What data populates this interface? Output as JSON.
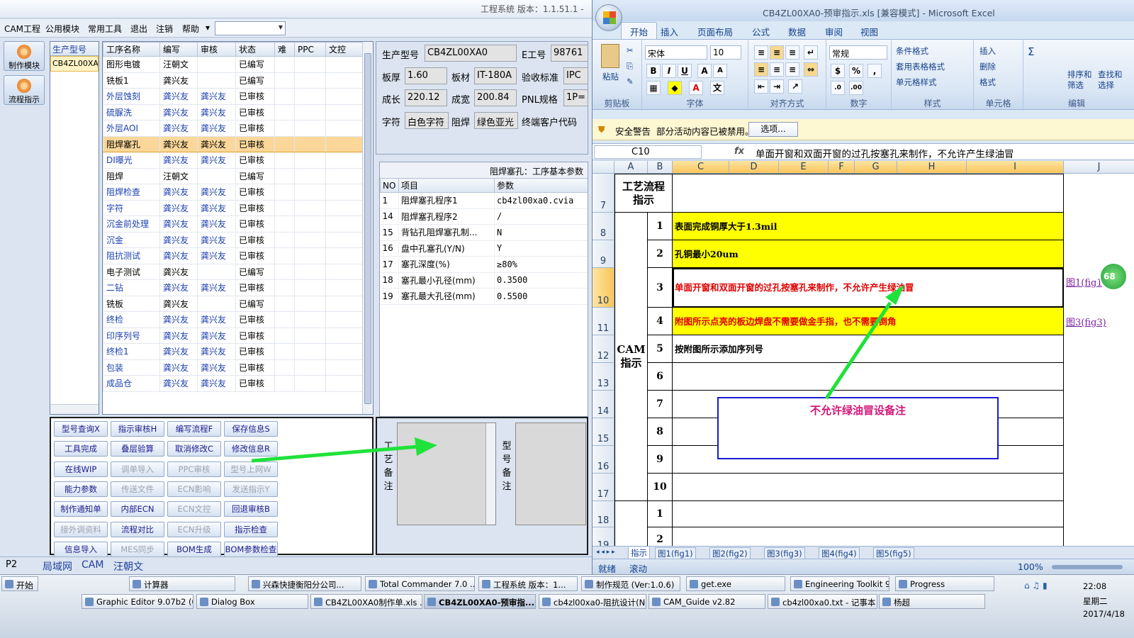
{
  "app": {
    "title": "工程系统  版本：1.1.51.1 -",
    "menu": [
      "CAM工程",
      "公用模块",
      "常用工具",
      "退出",
      "注销",
      "帮助"
    ],
    "menu_more": "▾",
    "side_buttons": [
      "制作模块",
      "流程指示"
    ],
    "product_list": {
      "header": "生产型号",
      "items": [
        "CB4ZL00XA0"
      ]
    },
    "process_grid": {
      "columns": [
        "工序名称",
        "编写",
        "审核",
        "状态",
        "难",
        "PPC",
        "文控"
      ],
      "rows": [
        {
          "name": "图形电镀",
          "writer": "汪朝文",
          "reviewer": "",
          "status": "已编写",
          "blue": false
        },
        {
          "name": "铣板1",
          "writer": "龚兴友",
          "reviewer": "",
          "status": "已编写",
          "blue": false
        },
        {
          "name": "外层蚀刻",
          "writer": "龚兴友",
          "reviewer": "龚兴友",
          "status": "已审核",
          "blue": true
        },
        {
          "name": "硫脲洗",
          "writer": "龚兴友",
          "reviewer": "龚兴友",
          "status": "已审核",
          "blue": true
        },
        {
          "name": "外层AOI",
          "writer": "龚兴友",
          "reviewer": "龚兴友",
          "status": "已审核",
          "blue": true
        },
        {
          "name": "阻焊塞孔",
          "writer": "龚兴友",
          "reviewer": "龚兴友",
          "status": "已审核",
          "blue": false,
          "selected": true
        },
        {
          "name": "DI曝光",
          "writer": "龚兴友",
          "reviewer": "龚兴友",
          "status": "已审核",
          "blue": true
        },
        {
          "name": "阻焊",
          "writer": "汪朝文",
          "reviewer": "",
          "status": "已编写",
          "blue": false
        },
        {
          "name": "阻焊检查",
          "writer": "龚兴友",
          "reviewer": "龚兴友",
          "status": "已审核",
          "blue": true
        },
        {
          "name": "字符",
          "writer": "龚兴友",
          "reviewer": "龚兴友",
          "status": "已审核",
          "blue": true
        },
        {
          "name": "沉金前处理",
          "writer": "龚兴友",
          "reviewer": "龚兴友",
          "status": "已审核",
          "blue": true
        },
        {
          "name": "沉金",
          "writer": "龚兴友",
          "reviewer": "龚兴友",
          "status": "已审核",
          "blue": true
        },
        {
          "name": "阻抗测试",
          "writer": "龚兴友",
          "reviewer": "龚兴友",
          "status": "已审核",
          "blue": true
        },
        {
          "name": "电子测试",
          "writer": "龚兴友",
          "reviewer": "",
          "status": "已编写",
          "blue": false
        },
        {
          "name": "二钻",
          "writer": "龚兴友",
          "reviewer": "龚兴友",
          "status": "已审核",
          "blue": true
        },
        {
          "name": "铣板",
          "writer": "龚兴友",
          "reviewer": "",
          "status": "已编写",
          "blue": false
        },
        {
          "name": "终检",
          "writer": "龚兴友",
          "reviewer": "龚兴友",
          "status": "已审核",
          "blue": true
        },
        {
          "name": "印序列号",
          "writer": "龚兴友",
          "reviewer": "龚兴友",
          "status": "已审核",
          "blue": true
        },
        {
          "name": "终检1",
          "writer": "龚兴友",
          "reviewer": "龚兴友",
          "status": "已审核",
          "blue": true
        },
        {
          "name": "包装",
          "writer": "龚兴友",
          "reviewer": "龚兴友",
          "status": "已审核",
          "blue": true
        },
        {
          "name": "成品仓",
          "writer": "龚兴友",
          "reviewer": "龚兴友",
          "status": "已审核",
          "blue": true
        }
      ]
    },
    "buttons": [
      {
        "label": "型号查询X",
        "disabled": false
      },
      {
        "label": "指示审核H",
        "disabled": false
      },
      {
        "label": "编写流程F",
        "disabled": false
      },
      {
        "label": "保存信息S",
        "disabled": false
      },
      {
        "label": "工具完成",
        "disabled": false
      },
      {
        "label": "叠层验算",
        "disabled": false
      },
      {
        "label": "取消修改C",
        "disabled": false
      },
      {
        "label": "修改信息R",
        "disabled": false
      },
      {
        "label": "在线WIP",
        "disabled": false
      },
      {
        "label": "调单导入",
        "disabled": true
      },
      {
        "label": "PPC审核",
        "disabled": true
      },
      {
        "label": "型号上网W",
        "disabled": true
      },
      {
        "label": "能力参数",
        "disabled": false
      },
      {
        "label": "传送文件",
        "disabled": true
      },
      {
        "label": "ECN影响",
        "disabled": true
      },
      {
        "label": "发送指示Y",
        "disabled": true
      },
      {
        "label": "制作通知单",
        "disabled": false
      },
      {
        "label": "内部ECN",
        "disabled": false
      },
      {
        "label": "ECN文控",
        "disabled": true
      },
      {
        "label": "回退审核B",
        "disabled": false
      },
      {
        "label": "接外调资料",
        "disabled": true
      },
      {
        "label": "流程对比",
        "disabled": false
      },
      {
        "label": "ECN升级",
        "disabled": true
      },
      {
        "label": "指示检查",
        "disabled": false
      },
      {
        "label": "信息导入",
        "disabled": false
      },
      {
        "label": "MES同步",
        "disabled": true
      },
      {
        "label": "BOM生成",
        "disabled": false
      },
      {
        "label": "BOM参数检查",
        "disabled": false
      }
    ],
    "info": {
      "model_label": "生产型号",
      "model_value": "CB4ZL00XA0",
      "eno_label": "E工号",
      "eno_value": "98761",
      "thick_label": "板厚",
      "thick_value": "1.60",
      "material_label": "板材",
      "material_value": "IT-180A",
      "accept_label": "验收标准",
      "accept_value": "IPC",
      "len_label": "成长",
      "len_value": "220.12",
      "width_label": "成宽",
      "width_value": "200.84",
      "pnl_label": "PNL规格",
      "pnl_value": "1P=",
      "char_label": "字符",
      "char_value": "白色字符",
      "mask_label": "阻焊",
      "mask_value": "绿色亚光",
      "cust_label": "终端客户代码"
    },
    "params": {
      "title": "阻焊塞孔：工序基本参数",
      "columns": [
        "NO",
        "项目",
        "参数"
      ],
      "rows": [
        {
          "no": "1",
          "item": "阻焊塞孔程序1",
          "val": "cb4zl00xa0.cvia"
        },
        {
          "no": "14",
          "item": "阻焊塞孔程序2",
          "val": "/"
        },
        {
          "no": "15",
          "item": "背钻孔阻焊塞孔制...",
          "val": "N"
        },
        {
          "no": "16",
          "item": "盘中孔塞孔(Y/N)",
          "val": "Y"
        },
        {
          "no": "17",
          "item": "塞孔深度(%)",
          "val": "≥80%"
        },
        {
          "no": "18",
          "item": "塞孔最小孔径(mm)",
          "val": "0.3500"
        },
        {
          "no": "19",
          "item": "塞孔最大孔径(mm)",
          "val": "0.5500"
        }
      ]
    },
    "remarks": {
      "process_label": "工艺备注",
      "model_label": "型号备注"
    },
    "status": [
      "P2",
      "局域网",
      "CAM",
      "汪朝文"
    ]
  },
  "excel": {
    "title": "CB4ZL00XA0-预审指示.xls [兼容模式] - Microsoft Excel",
    "tabs": [
      "开始",
      "插入",
      "页面布局",
      "公式",
      "数据",
      "审阅",
      "视图"
    ],
    "ribbon": {
      "clipboard": "剪贴板",
      "paste": "粘贴",
      "font": "字体",
      "font_name": "宋体",
      "font_size": "10",
      "align": "对齐方式",
      "number": "数字",
      "number_format": "常规",
      "styles": "样式",
      "cond_fmt": "条件格式",
      "table_fmt": "套用表格格式",
      "cell_style": "单元格样式",
      "cells": "单元格",
      "insert": "插入",
      "delete": "删除",
      "format": "格式",
      "edit": "编辑",
      "sort": "排序和\n筛选",
      "find": "查找和\n选择"
    },
    "security": {
      "title": "安全警告",
      "msg": "部分活动内容已被禁用。",
      "btn": "选项..."
    },
    "namebox": "C10",
    "formula": "单面开窗和双面开窗的过孔按塞孔来制作，不允许产生绿油冒",
    "columns": [
      "A",
      "B",
      "C",
      "D",
      "E",
      "F",
      "G",
      "H",
      "I",
      "J"
    ],
    "rows": [
      "7",
      "8",
      "9",
      "10",
      "11",
      "12",
      "13",
      "14",
      "15",
      "16",
      "17",
      "18",
      "19"
    ],
    "header_cell": "工艺流程\n指示",
    "cam_label": "CAM\n指示",
    "items": [
      {
        "n": "1",
        "text": "表面完成铜厚大于1.3mil",
        "color": "#000",
        "yellow": true
      },
      {
        "n": "2",
        "text": "孔铜最小20um",
        "color": "#000",
        "yellow": true
      },
      {
        "n": "3",
        "text": "单面开窗和双面开窗的过孔按塞孔来制作，不允许产生绿油冒",
        "color": "#e00000",
        "yellow": false
      },
      {
        "n": "4",
        "text": "附图所示点亮的板边焊盘不需要做金手指，也不需要倒角",
        "color": "#e00000",
        "yellow": true
      },
      {
        "n": "5",
        "text": "按附图所示添加序列号",
        "color": "#000",
        "yellow": false
      },
      {
        "n": "6",
        "text": "",
        "color": "#000",
        "yellow": false
      },
      {
        "n": "7",
        "text": "",
        "color": "#000",
        "yellow": false
      },
      {
        "n": "8",
        "text": "",
        "color": "#000",
        "yellow": false
      },
      {
        "n": "9",
        "text": "",
        "color": "#000",
        "yellow": false
      },
      {
        "n": "10",
        "text": "",
        "color": "#000",
        "yellow": false
      },
      {
        "n": "1",
        "text": "",
        "color": "#000",
        "yellow": false
      },
      {
        "n": "2",
        "text": "",
        "color": "#000",
        "yellow": false
      }
    ],
    "links": [
      "图1(fig1)",
      "图3(fig3)"
    ],
    "note": "不允许绿油冒设备注",
    "badge": "68",
    "sheet_tabs": [
      "指示",
      "图1(fig1)",
      "图2(fig2)",
      "图3(fig3)",
      "图4(fig4)",
      "图5(fig5)"
    ],
    "status_ready": "就绪",
    "status_scroll": "滚动",
    "zoom": "100%"
  },
  "taskbar": {
    "start": "开始",
    "row1": [
      "计算器",
      "兴森快捷衡阳分公司...",
      "Total Commander 7.0 ...",
      "工程系统  版本：1...",
      "制作规范 (Ver:1.0.6)",
      "get.exe",
      "Engineering Toolkit 9....",
      "Progress"
    ],
    "row2": [
      "Graphic Editor 9.07b2 (0...",
      "Dialog Box",
      "CB4ZL00XA0制作单.xls ...",
      "CB4ZL00XA0-预审指...",
      "cb4zl00xa0-阻抗设计(N...",
      "CAM_Guide v2.82",
      "cb4zl00xa0.txt - 记事本",
      "杨超"
    ],
    "time": "22:08",
    "weekday": "星期二",
    "date": "2017/4/18"
  }
}
